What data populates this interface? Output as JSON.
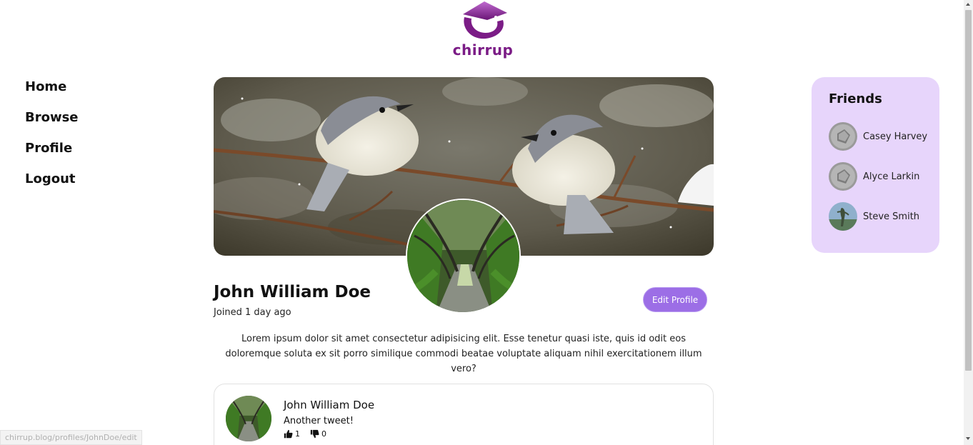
{
  "brand": {
    "logo_text": "chirrup",
    "color": "#7b1c86"
  },
  "nav": {
    "items": [
      {
        "label": "Home"
      },
      {
        "label": "Browse"
      },
      {
        "label": "Profile"
      },
      {
        "label": "Logout"
      }
    ]
  },
  "profile": {
    "name": "John William Doe",
    "joined": "Joined 1 day ago",
    "edit_label": "Edit Profile",
    "bio": "Lorem ipsum dolor sit amet consectetur adipisicing elit. Esse tenetur quasi iste, quis id odit eos doloremque soluta ex sit porro similique commodi beatae voluptate aliquam nihil exercitationem illum vero?",
    "banner_icon": "birds-on-branch-image",
    "avatar_icon": "tree-tunnel-image"
  },
  "tweets": [
    {
      "author": "John William Doe",
      "text": "Another tweet!",
      "likes": "1",
      "dislikes": "0"
    }
  ],
  "friends": {
    "title": "Friends",
    "items": [
      {
        "name": "Casey Harvey"
      },
      {
        "name": "Alyce Larkin"
      },
      {
        "name": "Steve Smith"
      }
    ]
  },
  "status_bar": {
    "url": "chirrup.blog/profiles/JohnDoe/edit"
  },
  "colors": {
    "accent": "#9c6ee6",
    "friends_bg": "#e7d5fb"
  }
}
